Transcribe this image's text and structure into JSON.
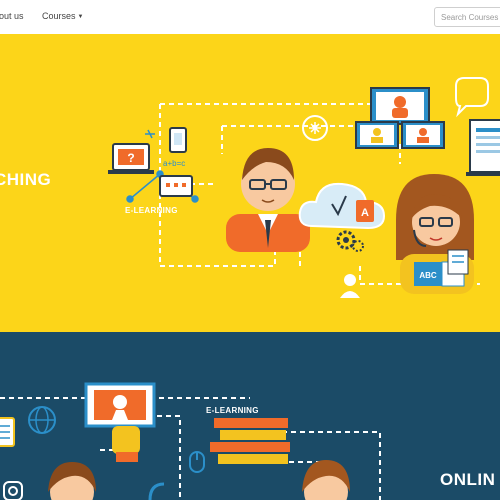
{
  "nav": {
    "about_label": "out us",
    "courses_label": "Courses",
    "search_placeholder": "Search Courses"
  },
  "hero": {
    "title": "CHING",
    "elearning_label": "E-LEARNING",
    "book_label": "ABC",
    "screen_letter": "?",
    "cloud_letter": "A",
    "formula_text": "a+b=c",
    "colors": {
      "background": "#fcd519",
      "accent_orange": "#f06b2a",
      "screen_blue": "#2b8fc9",
      "dark": "#2a3a4a"
    },
    "icons": [
      "laptop-question-icon",
      "phone-icon",
      "formula-icon",
      "chat-screen-icon",
      "teacher-avatar-icon",
      "cloud-icon",
      "gear-icon",
      "book-icon",
      "student-avatar-icon",
      "video-call-screen-icon",
      "speech-bubble-icon",
      "settings-circle-icon",
      "certificate-icon",
      "user-icon",
      "monitor-icon"
    ]
  },
  "section2": {
    "title": "ONLIN",
    "elearning_label": "E-LEARNING",
    "colors": {
      "background": "#1b4b67"
    },
    "icons": [
      "tablet-icon",
      "globe-icon",
      "hand-touch-icon",
      "books-stack-icon",
      "mouse-icon",
      "instagram-icon",
      "student-avatar-icon"
    ]
  }
}
